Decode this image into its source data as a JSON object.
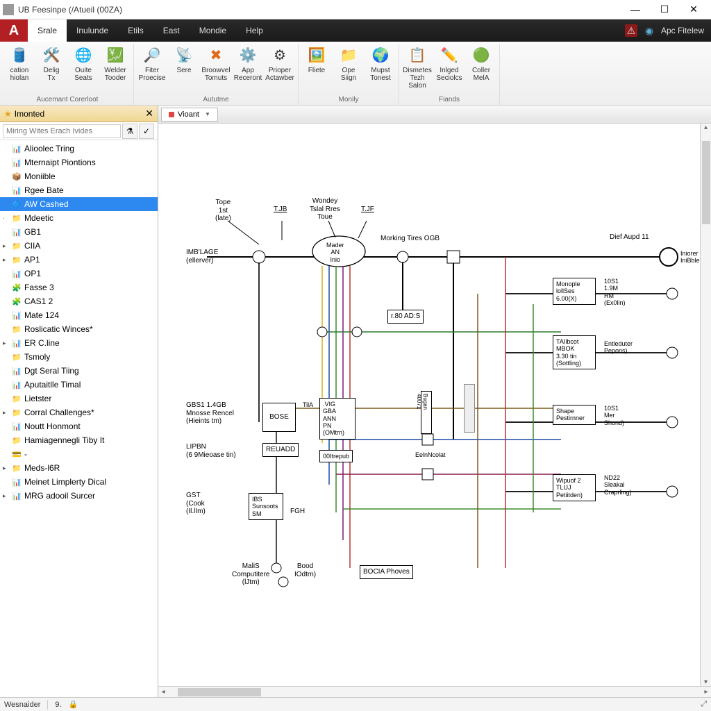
{
  "window": {
    "title": "UB Feesinpe (/Atueil (00ZA)"
  },
  "menu": {
    "items": [
      "Srale",
      "Inulunde",
      "Etils",
      "East",
      "Mondie",
      "Help"
    ],
    "active_index": 0,
    "right_label": "Apc Fitelew"
  },
  "ribbon": {
    "groups": [
      {
        "label": "Aucemant Corerloot",
        "buttons": [
          {
            "icon": "🛢️",
            "label": "cation\nhiolan"
          },
          {
            "icon": "🛠️",
            "label": "Delig\nTx"
          },
          {
            "icon": "🌐",
            "label": "Ouite\nSeats"
          },
          {
            "icon": "💹",
            "label": "Welder\nTooder"
          }
        ]
      },
      {
        "label": "Aututme",
        "buttons": [
          {
            "icon": "🔎",
            "label": "Fiter\nProecise"
          },
          {
            "icon": "📡",
            "label": "Sere"
          },
          {
            "icon": "✖",
            "label": "Broowvel\nTomuts",
            "red": true
          },
          {
            "icon": "⚙️",
            "label": "App\nReceront"
          },
          {
            "icon": "⚙",
            "label": "Prioper\nActawber"
          }
        ]
      },
      {
        "label": "Monily",
        "buttons": [
          {
            "icon": "🖼️",
            "label": "Fliete"
          },
          {
            "icon": "📁",
            "label": "Ope\nSiign"
          },
          {
            "icon": "🌍",
            "label": "Mupst\nTonest"
          }
        ]
      },
      {
        "label": "Fiands",
        "buttons": [
          {
            "icon": "📋",
            "label": "Dismetes\nTezh Salon"
          },
          {
            "icon": "✏️",
            "label": "Inlged\nSeciolcs"
          },
          {
            "icon": "🟢",
            "label": "Coller\nMelA"
          }
        ]
      }
    ]
  },
  "sidebar": {
    "tab": "Imonted",
    "search_placeholder": "Miring Wites Erach Ivides",
    "items": [
      {
        "ico": "📊",
        "label": "Alioolec Tring",
        "arrow": ""
      },
      {
        "ico": "📊",
        "label": "Mternaipt Piontions",
        "arrow": ""
      },
      {
        "ico": "📦",
        "label": "Moniible",
        "arrow": ""
      },
      {
        "ico": "📊",
        "label": "Rgee Bate",
        "arrow": ""
      },
      {
        "ico": "🔷",
        "label": "AW Cashed",
        "arrow": "",
        "sel": true
      },
      {
        "ico": "📁",
        "label": "Mdeetic",
        "arrow": "·"
      },
      {
        "ico": "📊",
        "label": "GB1",
        "arrow": ""
      },
      {
        "ico": "📁",
        "label": "CIIA",
        "arrow": "▸"
      },
      {
        "ico": "📁",
        "label": "AP1",
        "arrow": "▸"
      },
      {
        "ico": "📊",
        "label": "OP1",
        "arrow": ""
      },
      {
        "ico": "🧩",
        "label": "Fasse 3",
        "arrow": ""
      },
      {
        "ico": "🧩",
        "label": "CAS1 2",
        "arrow": ""
      },
      {
        "ico": "📊",
        "label": "Mate 124",
        "arrow": ""
      },
      {
        "ico": "📁",
        "label": "Roslicatic Winces*",
        "arrow": ""
      },
      {
        "ico": "📊",
        "label": "ER C.line",
        "arrow": "▸"
      },
      {
        "ico": "📁",
        "label": "Tsmoly",
        "arrow": ""
      },
      {
        "ico": "📊",
        "label": "Dgt Seral Tiing",
        "arrow": ""
      },
      {
        "ico": "📊",
        "label": "Aputaitlle Timal",
        "arrow": ""
      },
      {
        "ico": "📁",
        "label": "Lietster",
        "arrow": ""
      },
      {
        "ico": "📁",
        "label": "Corral Challenges*",
        "arrow": "▸"
      },
      {
        "ico": "📊",
        "label": "Noutt Honmont",
        "arrow": ""
      },
      {
        "ico": "📁",
        "label": "Hamiagennegli Tiby It",
        "arrow": ""
      },
      {
        "ico": "💳",
        "label": "-",
        "arrow": ""
      },
      {
        "ico": "📁",
        "label": "Meds-l6R",
        "arrow": "▸"
      },
      {
        "ico": "📊",
        "label": "Meinet Limplerty Dical",
        "arrow": ""
      },
      {
        "ico": "📊",
        "label": "MRG adooil Surcer",
        "arrow": "▸"
      }
    ]
  },
  "canvas": {
    "tab": "Vioant",
    "labels": {
      "tope": "Tope\n1st\n(late)",
      "tjb": "T.JB",
      "wondey": "Wondey\nTslal Rres\nToue",
      "tjf": "T.JF",
      "mader": "Mader\nAN\nInio",
      "morking": "Morking Tires OGB",
      "dief": "Dief Aupd 11",
      "inibble": "Iniorer\nIniBble",
      "imglage": "IMB'LAGE\n(ellerver)",
      "ads": "r.80 AD:S",
      "gbs": "GBS1 1.4GB\nMnosse Rencel\n(Hieints tm)",
      "bose": "BOSE",
      "tila": "TilA",
      "vig": ".VIG\nGBA\nANN\nPN\n(OMtrn)",
      "lipbn": "LIPBN\n(6 9Mieoase tin)",
      "reuadd": "REUADD",
      "outrepub": "00Itrepub",
      "eelnt": "EelnNcolat",
      "gst": "GST\n(Cook\n(Il.lIm)",
      "ibs": "IBS\nSunsoots\nSM",
      "fgh": "FGH",
      "malis": "MaliS\nComputitere\n(lJtm)",
      "bood": "Bood\nIOdtrn)",
      "bocia": "BOCIA Phoves",
      "monople": "Monople\nlollSes\n6.00(X)",
      "m10s1a": "10S1\n1.9M\nRM\n(Ex0lin)",
      "talibcot": "TAIlbcot\nMBOK\n3.30 tin\n(Sottling)",
      "entleduter": "Entleduter\nPepons)",
      "shape": "Shape\nPestirnner",
      "m10s1b": "10S1\nMer\nShond)",
      "wipuof": "Wipuof 2\nTLUJ\nPetiitden)",
      "nd22": "ND22\nSleakal\nCraprling)"
    }
  },
  "status": {
    "left": "Wesnaider",
    "num": "9."
  }
}
